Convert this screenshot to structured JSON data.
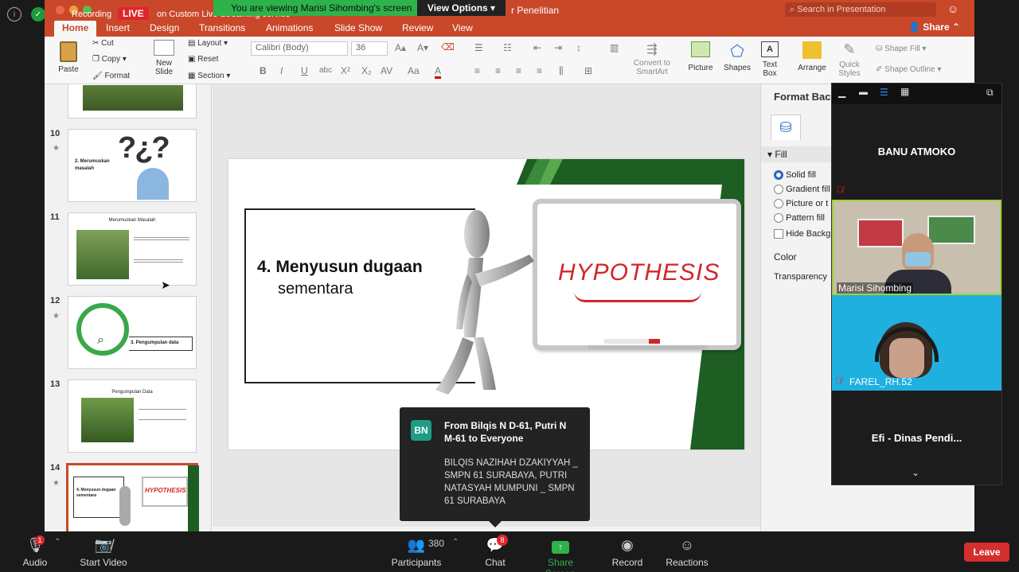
{
  "zoom_top": {
    "recording_label": "Recording",
    "live_label": "LIVE",
    "streaming_label": "on Custom Live Streaming service",
    "viewing_banner": "You are viewing Marisi Sihombing's screen",
    "view_options_label": "View Options"
  },
  "ppt": {
    "doc_title_fragment": "r Penelitian",
    "search_placeholder": "Search in Presentation",
    "share_label": "Share",
    "tabs": [
      "Home",
      "Insert",
      "Design",
      "Transitions",
      "Animations",
      "Slide Show",
      "Review",
      "View"
    ],
    "ribbon": {
      "paste": "Paste",
      "cut": "Cut",
      "copy": "Copy",
      "format": "Format",
      "new_slide_1": "New",
      "new_slide_2": "Slide",
      "layout": "Layout",
      "reset": "Reset",
      "section": "Section",
      "font_name": "Calibri (Body)",
      "font_size": "36",
      "convert_1": "Convert to",
      "convert_2": "SmartArt",
      "picture": "Picture",
      "shapes": "Shapes",
      "textbox_1": "Text",
      "textbox_2": "Box",
      "arrange": "Arrange",
      "quick_styles_1": "Quick",
      "quick_styles_2": "Styles",
      "shape_fill": "Shape Fill",
      "shape_outline": "Shape Outline"
    },
    "thumbs": [
      {
        "num": "10",
        "title": "2. Merumuskan masalah"
      },
      {
        "num": "11",
        "title": "Merumuskan Masalah"
      },
      {
        "num": "12",
        "title": "3. Pengumpulan data"
      },
      {
        "num": "13",
        "title": "Pengumpulan Data"
      },
      {
        "num": "14",
        "title": "4. Menyusun dugaan sementara",
        "word": "HYPOTHESIS"
      }
    ],
    "slide": {
      "heading_line1": "4. Menyusun dugaan",
      "heading_line2": "sementara",
      "board_word": "HYPOTHESIS"
    },
    "format_pane": {
      "title": "Format Bac",
      "fill_header": "Fill",
      "options": [
        "Solid fill",
        "Gradient fill",
        "Picture or t",
        "Pattern fill"
      ],
      "hide_bg": "Hide Backg",
      "color_label": "Color",
      "transparency_label": "Transparency"
    }
  },
  "gallery": {
    "participants": [
      {
        "name": "BANU ATMOKO"
      },
      {
        "name": "Marisi Sihombing"
      },
      {
        "name": "FAREL_RH.52"
      },
      {
        "name": "Efi - Dinas Pendi..."
      }
    ]
  },
  "chat_popup": {
    "avatar_initials": "BN",
    "header": "From Bilqis N D-61, Putri N M-61 to Everyone",
    "message": "BILQIS NAZIHAH DZAKIYYAH _ SMPN 61 SURABAYA, PUTRI NATASYAH MUMPUNI _ SMPN 61 SURABAYA"
  },
  "toolbar": {
    "audio": "Audio",
    "audio_badge": "1",
    "start_video": "Start Video",
    "participants": "Participants",
    "participants_count": "380",
    "chat": "Chat",
    "chat_badge": "8",
    "share_screen": "Share Screen",
    "record": "Record",
    "reactions": "Reactions",
    "leave": "Leave"
  },
  "colors": {
    "ppt_accent": "#c9482a",
    "zoom_green": "#2db34a",
    "leave_red": "#d32f2f",
    "slide_green": "#1e5e23",
    "hypothesis_red": "#d0262b"
  }
}
